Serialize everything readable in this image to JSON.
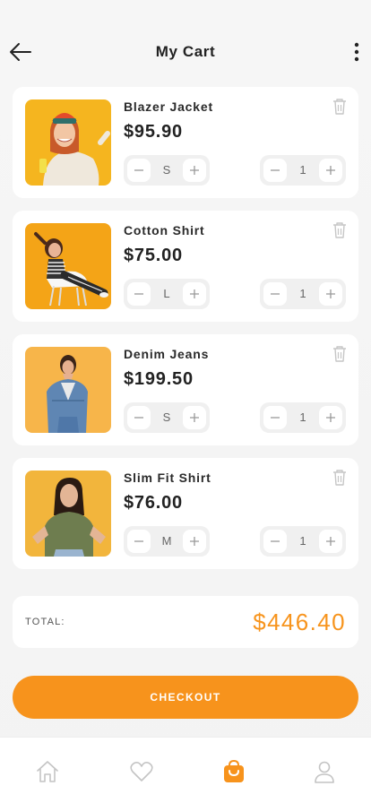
{
  "header": {
    "title": "My Cart"
  },
  "cart": {
    "items": [
      {
        "name": "Blazer Jacket",
        "price": "$95.90",
        "size": "S",
        "qty": "1"
      },
      {
        "name": "Cotton Shirt",
        "price": "$75.00",
        "size": "L",
        "qty": "1"
      },
      {
        "name": "Denim Jeans",
        "price": "$199.50",
        "size": "S",
        "qty": "1"
      },
      {
        "name": "Slim Fit Shirt",
        "price": "$76.00",
        "size": "M",
        "qty": "1"
      }
    ]
  },
  "summary": {
    "total_label": "TOTAL:",
    "total_value": "$446.40"
  },
  "checkout": {
    "label": "CHECKOUT"
  },
  "tabbar": {
    "active": "cart",
    "icons": [
      "home-icon",
      "heart-icon",
      "shopping-bag-icon",
      "user-icon"
    ]
  },
  "colors": {
    "accent": "#f7931c",
    "background": "#f4f4f4",
    "icon_inactive": "#c4c4c4"
  }
}
